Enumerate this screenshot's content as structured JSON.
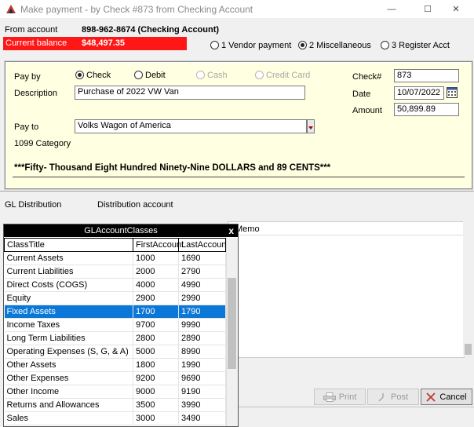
{
  "window": {
    "title": "Make payment - by Check #873 from Checking Account",
    "minimize": "—",
    "maximize": "☐",
    "close": "✕"
  },
  "header": {
    "from_account_label": "From account",
    "from_account_value": "898-962-8674 (Checking Account)",
    "current_balance_label": "Current balance",
    "current_balance_value": "$48,497.35",
    "payment_types": [
      {
        "label": "1 Vendor payment",
        "selected": false
      },
      {
        "label": "2 Miscellaneous",
        "selected": true
      },
      {
        "label": "3 Register Acct",
        "selected": false
      }
    ]
  },
  "form": {
    "pay_by_label": "Pay by",
    "pay_by_options": [
      {
        "label": "Check",
        "selected": true,
        "enabled": true
      },
      {
        "label": "Debit",
        "selected": false,
        "enabled": true
      },
      {
        "label": "Cash",
        "selected": false,
        "enabled": false
      },
      {
        "label": "Credit Card",
        "selected": false,
        "enabled": false
      }
    ],
    "description_label": "Description",
    "description_value": "Purchase of 2022 VW Van",
    "pay_to_label": "Pay to",
    "pay_to_value": "Volks Wagon of America",
    "category_label": "1099 Category",
    "check_label": "Check#",
    "check_value": "873",
    "date_label": "Date",
    "date_value": "10/07/2022",
    "amount_label": "Amount",
    "amount_value": "50,899.89",
    "amount_words": "***Fifty- Thousand Eight Hundred Ninety-Nine DOLLARS and 89 CENTS***"
  },
  "distribution": {
    "gl_label": "GL Distribution",
    "account_label": "Distribution account",
    "memo_label": "Memo"
  },
  "popup": {
    "title": "GLAccountClasses",
    "close": "x",
    "columns": [
      "ClassTitle",
      "FirstAccount",
      "LastAccount"
    ],
    "rows": [
      {
        "title": "Current Assets",
        "first": "1000",
        "last": "1690",
        "selected": false
      },
      {
        "title": "Current Liabilities",
        "first": "2000",
        "last": "2790",
        "selected": false
      },
      {
        "title": "Direct Costs (COGS)",
        "first": "4000",
        "last": "4990",
        "selected": false
      },
      {
        "title": "Equity",
        "first": "2900",
        "last": "2990",
        "selected": false
      },
      {
        "title": "Fixed Assets",
        "first": "1700",
        "last": "1790",
        "selected": true
      },
      {
        "title": "Income Taxes",
        "first": "9700",
        "last": "9990",
        "selected": false
      },
      {
        "title": "Long Term Liabilities",
        "first": "2800",
        "last": "2890",
        "selected": false
      },
      {
        "title": "Operating Expenses (S, G, & A)",
        "first": "5000",
        "last": "8990",
        "selected": false
      },
      {
        "title": "Other Assets",
        "first": "1800",
        "last": "1990",
        "selected": false
      },
      {
        "title": "Other Expenses",
        "first": "9200",
        "last": "9690",
        "selected": false
      },
      {
        "title": "Other Income",
        "first": "9000",
        "last": "9190",
        "selected": false
      },
      {
        "title": "Returns and Allowances",
        "first": "3500",
        "last": "3990",
        "selected": false
      },
      {
        "title": "Sales",
        "first": "3000",
        "last": "3490",
        "selected": false
      }
    ]
  },
  "buttons": {
    "print": "Print",
    "post": "Post",
    "cancel": "Cancel"
  },
  "colors": {
    "balance_bg": "#ff1616",
    "panel_bg": "#ffffe1",
    "selection": "#0b78d7"
  }
}
